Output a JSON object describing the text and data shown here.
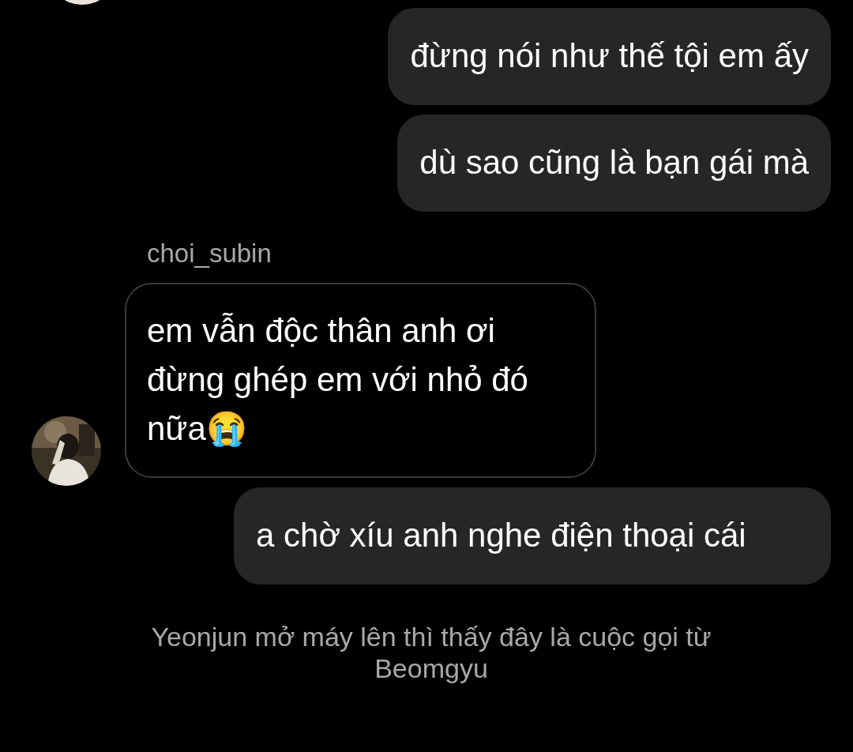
{
  "messages": [
    {
      "kind": "sent",
      "text": "đừng nói như thế tội em ấy"
    },
    {
      "kind": "sent",
      "text": "dù sao cũng là bạn gái mà"
    },
    {
      "kind": "received",
      "sender": "choi_subin",
      "text": "em vẫn độc thân anh ơi đừng ghép em với nhỏ đó nữa😭"
    },
    {
      "kind": "sent",
      "text": "a chờ xíu anh nghe điện thoại cái"
    }
  ],
  "caption": "Yeonjun mở máy lên thì thấy đây là cuộc gọi từ Beomgyu"
}
